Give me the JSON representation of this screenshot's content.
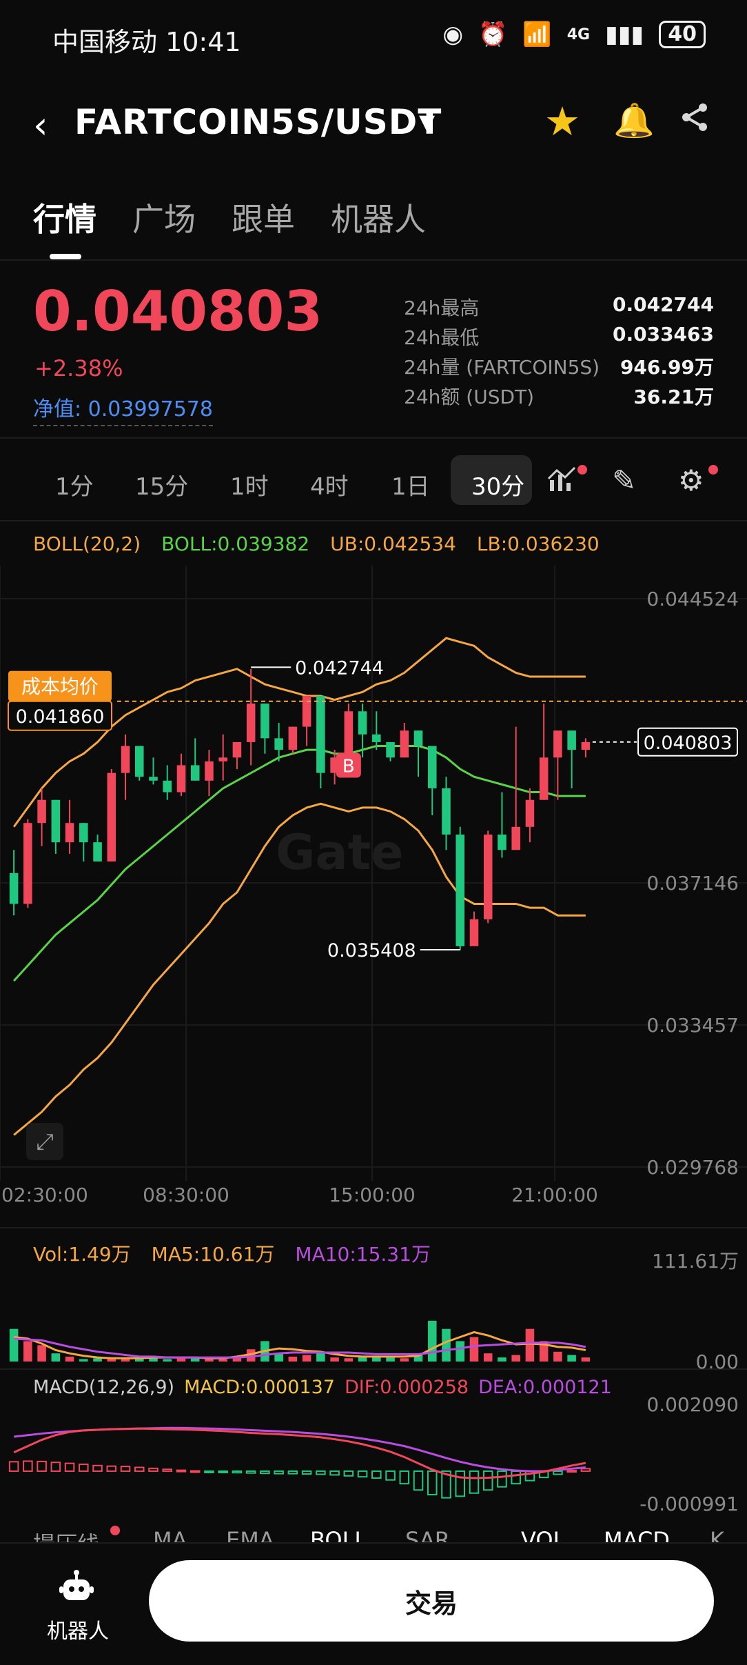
{
  "status_bar": {
    "carrier_time": "中国移动 10:41",
    "network": "4G",
    "battery": "40"
  },
  "header": {
    "pair": "FARTCOIN5S/USDT"
  },
  "tabs": [
    "行情",
    "广场",
    "跟单",
    "机器人"
  ],
  "ticker": {
    "price": "0.040803",
    "change": "+2.38%",
    "net_value": "净值: 0.03997578",
    "stats": [
      {
        "label": "24h最高",
        "value": "0.042744"
      },
      {
        "label": "24h最低",
        "value": "0.033463"
      },
      {
        "label": "24h量 (FARTCOIN5S)",
        "value": "946.99万"
      },
      {
        "label": "24h额 (USDT)",
        "value": "36.21万"
      }
    ]
  },
  "intervals": [
    "1分",
    "15分",
    "1时",
    "4时",
    "1日",
    "30分"
  ],
  "active_interval": "30分",
  "boll_legend": {
    "params": "BOLL(20,2)",
    "boll": "BOLL:0.039382",
    "ub": "UB:0.042534",
    "lb": "LB:0.036230"
  },
  "chart_labels": {
    "cost_avg_label": "成本均价",
    "cost_avg_value": "0.041860",
    "last_price": "0.040803",
    "high_marker": "0.042744",
    "low_marker": "0.035408",
    "buy_marker": "B",
    "watermark": "Gate"
  },
  "vol_legend": {
    "vol": "Vol:1.49万",
    "ma5": "MA5:10.61万",
    "ma10": "MA10:15.31万"
  },
  "macd_legend": {
    "params": "MACD(12,26,9)",
    "macd": "MACD:0.000137",
    "dif": "DIF:0.000258",
    "dea": "DEA:0.000121"
  },
  "indicator_tabs": [
    "撮压线",
    "MA",
    "EMA",
    "BOLL",
    "SAR",
    "VOL",
    "MACD",
    "K"
  ],
  "bottom": {
    "robot_label": "机器人",
    "trade_label": "交易"
  },
  "colors": {
    "up": "#f0475a",
    "down": "#1fc77f",
    "boll_mid": "#5bd348",
    "boll_band": "#f4a742",
    "accent_blue": "#4d8ef7",
    "star": "#f5c518"
  },
  "chart_data": {
    "type": "candlestick",
    "x_ticks": [
      "02:30:00",
      "08:30:00",
      "15:00:00",
      "21:00:00"
    ],
    "y_ticks": [
      "0.044524",
      "0.037146",
      "0.033457",
      "0.029768"
    ],
    "price_range": [
      0.029768,
      0.044524
    ],
    "candles": [
      {
        "o": 0.0374,
        "h": 0.038,
        "l": 0.0363,
        "c": 0.0366
      },
      {
        "o": 0.0366,
        "h": 0.0388,
        "l": 0.0365,
        "c": 0.0387
      },
      {
        "o": 0.0387,
        "h": 0.0396,
        "l": 0.0381,
        "c": 0.0393
      },
      {
        "o": 0.0393,
        "h": 0.0393,
        "l": 0.0379,
        "c": 0.0382
      },
      {
        "o": 0.0382,
        "h": 0.0393,
        "l": 0.0379,
        "c": 0.0387
      },
      {
        "o": 0.0387,
        "h": 0.0387,
        "l": 0.0377,
        "c": 0.0382
      },
      {
        "o": 0.0382,
        "h": 0.0384,
        "l": 0.0377,
        "c": 0.0377
      },
      {
        "o": 0.0377,
        "h": 0.0401,
        "l": 0.0377,
        "c": 0.04
      },
      {
        "o": 0.04,
        "h": 0.041,
        "l": 0.0393,
        "c": 0.0407
      },
      {
        "o": 0.0407,
        "h": 0.0407,
        "l": 0.0398,
        "c": 0.0399
      },
      {
        "o": 0.0399,
        "h": 0.0404,
        "l": 0.0397,
        "c": 0.0398
      },
      {
        "o": 0.0398,
        "h": 0.0402,
        "l": 0.0393,
        "c": 0.0395
      },
      {
        "o": 0.0395,
        "h": 0.0405,
        "l": 0.0394,
        "c": 0.0402
      },
      {
        "o": 0.0402,
        "h": 0.0409,
        "l": 0.0398,
        "c": 0.0398
      },
      {
        "o": 0.0398,
        "h": 0.0406,
        "l": 0.0394,
        "c": 0.0403
      },
      {
        "o": 0.0403,
        "h": 0.041,
        "l": 0.0398,
        "c": 0.0404
      },
      {
        "o": 0.0404,
        "h": 0.0408,
        "l": 0.0401,
        "c": 0.0408
      },
      {
        "o": 0.0408,
        "h": 0.0427,
        "l": 0.0402,
        "c": 0.0418
      },
      {
        "o": 0.0418,
        "h": 0.0418,
        "l": 0.0405,
        "c": 0.0409
      },
      {
        "o": 0.0409,
        "h": 0.0413,
        "l": 0.0403,
        "c": 0.0406
      },
      {
        "o": 0.0406,
        "h": 0.0412,
        "l": 0.0405,
        "c": 0.0412
      },
      {
        "o": 0.0412,
        "h": 0.0418,
        "l": 0.0407,
        "c": 0.042
      },
      {
        "o": 0.042,
        "h": 0.042,
        "l": 0.0396,
        "c": 0.04
      },
      {
        "o": 0.04,
        "h": 0.0406,
        "l": 0.0397,
        "c": 0.0404
      },
      {
        "o": 0.0404,
        "h": 0.0418,
        "l": 0.0403,
        "c": 0.0416
      },
      {
        "o": 0.0416,
        "h": 0.0418,
        "l": 0.0404,
        "c": 0.041
      },
      {
        "o": 0.041,
        "h": 0.0416,
        "l": 0.0406,
        "c": 0.0408
      },
      {
        "o": 0.0408,
        "h": 0.0408,
        "l": 0.0403,
        "c": 0.0404
      },
      {
        "o": 0.0404,
        "h": 0.0413,
        "l": 0.0404,
        "c": 0.0411
      },
      {
        "o": 0.0411,
        "h": 0.0411,
        "l": 0.0399,
        "c": 0.0407
      },
      {
        "o": 0.0407,
        "h": 0.0407,
        "l": 0.0389,
        "c": 0.0396
      },
      {
        "o": 0.0396,
        "h": 0.0399,
        "l": 0.038,
        "c": 0.0384
      },
      {
        "o": 0.0384,
        "h": 0.0386,
        "l": 0.0354,
        "c": 0.0355
      },
      {
        "o": 0.0355,
        "h": 0.0364,
        "l": 0.0356,
        "c": 0.0362
      },
      {
        "o": 0.0362,
        "h": 0.0385,
        "l": 0.0361,
        "c": 0.0384
      },
      {
        "o": 0.0384,
        "h": 0.0395,
        "l": 0.0378,
        "c": 0.038
      },
      {
        "o": 0.038,
        "h": 0.0412,
        "l": 0.038,
        "c": 0.0386
      },
      {
        "o": 0.0386,
        "h": 0.0396,
        "l": 0.0382,
        "c": 0.0393
      },
      {
        "o": 0.0393,
        "h": 0.0418,
        "l": 0.0393,
        "c": 0.0404
      },
      {
        "o": 0.0404,
        "h": 0.0408,
        "l": 0.0393,
        "c": 0.0411
      },
      {
        "o": 0.0411,
        "h": 0.0411,
        "l": 0.0396,
        "c": 0.0406
      },
      {
        "o": 0.0406,
        "h": 0.0409,
        "l": 0.0404,
        "c": 0.0408
      }
    ],
    "boll_upper": [
      0.0386,
      0.0391,
      0.0396,
      0.04,
      0.0403,
      0.0405,
      0.0408,
      0.0412,
      0.0415,
      0.0417,
      0.0419,
      0.0421,
      0.0422,
      0.0424,
      0.0425,
      0.0426,
      0.0427,
      0.0425,
      0.0423,
      0.0422,
      0.0421,
      0.042,
      0.042,
      0.0419,
      0.042,
      0.0421,
      0.0423,
      0.0424,
      0.0426,
      0.0429,
      0.0432,
      0.0435,
      0.0434,
      0.0433,
      0.043,
      0.0428,
      0.0426,
      0.0425,
      0.0425,
      0.0425,
      0.0425,
      0.0425
    ],
    "boll_mid": [
      0.0346,
      0.035,
      0.0354,
      0.0358,
      0.0361,
      0.0364,
      0.0367,
      0.0371,
      0.0375,
      0.0378,
      0.0381,
      0.0384,
      0.0387,
      0.039,
      0.0393,
      0.0396,
      0.0398,
      0.04,
      0.0402,
      0.0404,
      0.0405,
      0.0406,
      0.0406,
      0.0405,
      0.0405,
      0.0406,
      0.0407,
      0.0407,
      0.0407,
      0.0407,
      0.0406,
      0.0404,
      0.0401,
      0.0399,
      0.0398,
      0.0397,
      0.0396,
      0.0395,
      0.0395,
      0.0394,
      0.0394,
      0.0394
    ],
    "boll_lower": [
      0.0306,
      0.0309,
      0.0312,
      0.0316,
      0.0319,
      0.0323,
      0.0326,
      0.033,
      0.0335,
      0.034,
      0.0345,
      0.0349,
      0.0353,
      0.0357,
      0.0361,
      0.0366,
      0.0369,
      0.0375,
      0.0381,
      0.0386,
      0.0389,
      0.0391,
      0.0392,
      0.0391,
      0.039,
      0.0391,
      0.0391,
      0.039,
      0.0388,
      0.0385,
      0.038,
      0.0373,
      0.0368,
      0.0366,
      0.0366,
      0.0366,
      0.0366,
      0.0365,
      0.0365,
      0.0363,
      0.0363,
      0.0363
    ],
    "volume_range": [
      0,
      111.61
    ],
    "volumes": [
      40,
      25,
      20,
      10,
      6,
      3,
      4,
      4,
      3,
      5,
      6,
      3,
      4,
      5,
      3,
      3,
      5,
      15,
      25,
      10,
      6,
      8,
      10,
      5,
      4,
      6,
      7,
      5,
      4,
      10,
      50,
      40,
      25,
      30,
      10,
      5,
      8,
      40,
      25,
      12,
      8,
      5
    ],
    "vol_ma5": [
      30,
      28,
      22,
      14,
      10,
      7,
      5,
      4,
      4,
      4,
      5,
      5,
      5,
      5,
      4,
      4,
      6,
      9,
      13,
      16,
      15,
      13,
      12,
      9,
      7,
      6,
      6,
      6,
      6,
      7,
      16,
      24,
      30,
      36,
      32,
      26,
      21,
      22,
      21,
      18,
      17,
      14
    ],
    "vol_ma10": [
      28,
      27,
      26,
      22,
      18,
      15,
      12,
      10,
      8,
      6,
      6,
      5,
      5,
      5,
      5,
      5,
      5,
      6,
      8,
      10,
      11,
      11,
      11,
      11,
      11,
      10,
      9,
      9,
      9,
      9,
      11,
      14,
      16,
      19,
      20,
      21,
      22,
      23,
      23,
      23,
      21,
      18
    ],
    "macd_range": [
      -0.000991,
      0.00209
    ],
    "macd_hist": [
      0.0003,
      0.00032,
      0.00031,
      0.00028,
      0.00025,
      0.00022,
      0.00018,
      0.00016,
      0.00015,
      0.00012,
      9e-05,
      6e-05,
      3e-05,
      1e-05,
      -2e-05,
      -4e-05,
      -5e-05,
      -6e-05,
      -7e-05,
      -8e-05,
      -8e-05,
      -9e-05,
      -0.0001,
      -0.00012,
      -0.00015,
      -0.00018,
      -0.00022,
      -0.00028,
      -0.0004,
      -0.0006,
      -0.00075,
      -0.00085,
      -0.0008,
      -0.0007,
      -0.0006,
      -0.0005,
      -0.0004,
      -0.0003,
      -0.0002,
      -0.0001,
      2e-05,
      8e-05
    ],
    "dif": [
      0.0006,
      0.0008,
      0.001,
      0.00115,
      0.00125,
      0.0013,
      0.00132,
      0.00134,
      0.00135,
      0.00136,
      0.00135,
      0.00134,
      0.00133,
      0.00132,
      0.0013,
      0.00128,
      0.00125,
      0.00122,
      0.0012,
      0.00118,
      0.00115,
      0.00112,
      0.00108,
      0.00102,
      0.00095,
      0.00086,
      0.00075,
      0.00062,
      0.00045,
      0.00025,
      5e-05,
      -0.0001,
      -0.0002,
      -0.00022,
      -0.00021,
      -0.00018,
      -0.00013,
      -8e-05,
      -2e-05,
      8e-05,
      0.00018,
      0.00026
    ],
    "dea": [
      0.0011,
      0.00115,
      0.0012,
      0.00124,
      0.00127,
      0.0013,
      0.00132,
      0.00134,
      0.00135,
      0.00136,
      0.00137,
      0.00138,
      0.00138,
      0.00137,
      0.00136,
      0.00135,
      0.00133,
      0.00131,
      0.00129,
      0.00127,
      0.00125,
      0.00122,
      0.00119,
      0.00115,
      0.0011,
      0.00104,
      0.00097,
      0.00089,
      0.0008,
      0.00068,
      0.00055,
      0.00042,
      0.0003,
      0.0002,
      0.00012,
      6e-05,
      2e-05,
      0.0,
      0.0,
      4e-05,
      8e-05,
      0.00012
    ]
  }
}
